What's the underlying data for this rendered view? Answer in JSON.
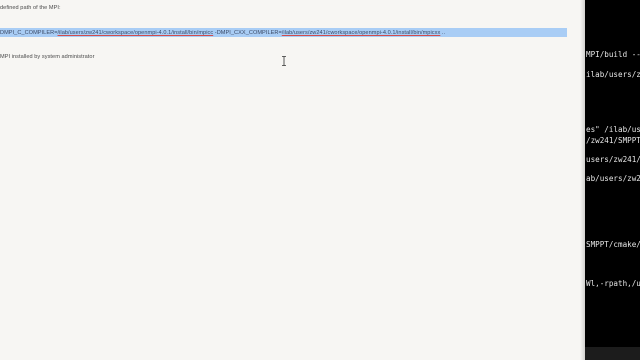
{
  "document": {
    "line1": "defined path of the MPI:",
    "cmd_part1": "DMPI_C_COMPILER=",
    "cmd_path1": "/ilab/users/zw241/cworkspace/openmpi-4.0.1/install/bin/mpicc",
    "cmd_part2": " -DMPI_CXX_COMPILER=",
    "cmd_path2": "/ilab/users/zw241/cworkspace/openmpi-4.0.1/install/bin/mpicxx",
    "cmd_tail": " ..",
    "line3": "MPI installed by system administrator"
  },
  "terminal": {
    "lines": [
      "MPI/build --",
      "ilab/users/z",
      "es\" /ilab/us",
      "/zw241/SMPPT",
      "users/zw241/",
      "ab/users/zw2",
      "SMPPT/cmake/",
      "Wl,-rpath,/u"
    ]
  },
  "colors": {
    "selection": "#a9cdf5",
    "document_bg": "#f7f6f3",
    "terminal_bg": "#000000",
    "terminal_text": "#e6e6e6"
  },
  "icons": {
    "cursor": "text-i-beam-cursor"
  }
}
